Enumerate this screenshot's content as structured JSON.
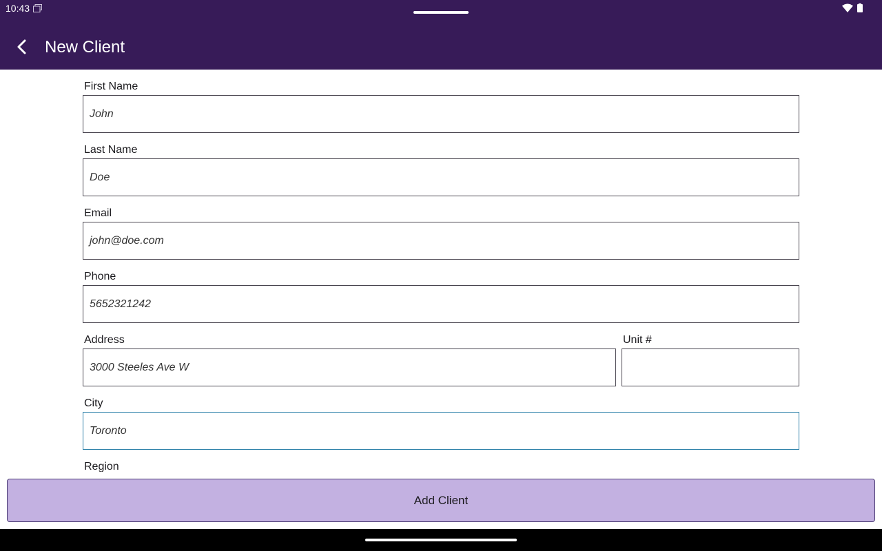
{
  "status_bar": {
    "time": "10:43",
    "icons": [
      "screen-icon",
      "wifi-icon",
      "battery-icon"
    ]
  },
  "app_bar": {
    "title": "New Client",
    "back_icon": "chevron-left-icon"
  },
  "form": {
    "first_name": {
      "label": "First Name",
      "value": "John"
    },
    "last_name": {
      "label": "Last Name",
      "value": "Doe"
    },
    "email": {
      "label": "Email",
      "value": "john@doe.com"
    },
    "phone": {
      "label": "Phone",
      "value": "5652321242"
    },
    "address": {
      "label": "Address",
      "value": "3000 Steeles Ave W"
    },
    "unit": {
      "label": "Unit #",
      "value": ""
    },
    "city": {
      "label": "City",
      "value": "Toronto"
    },
    "region": {
      "label": "Region"
    }
  },
  "actions": {
    "add_client_label": "Add Client"
  },
  "colors": {
    "primary": "#371b58",
    "button_bg": "#c3b1e1",
    "focus_border": "#2a7fa8"
  }
}
